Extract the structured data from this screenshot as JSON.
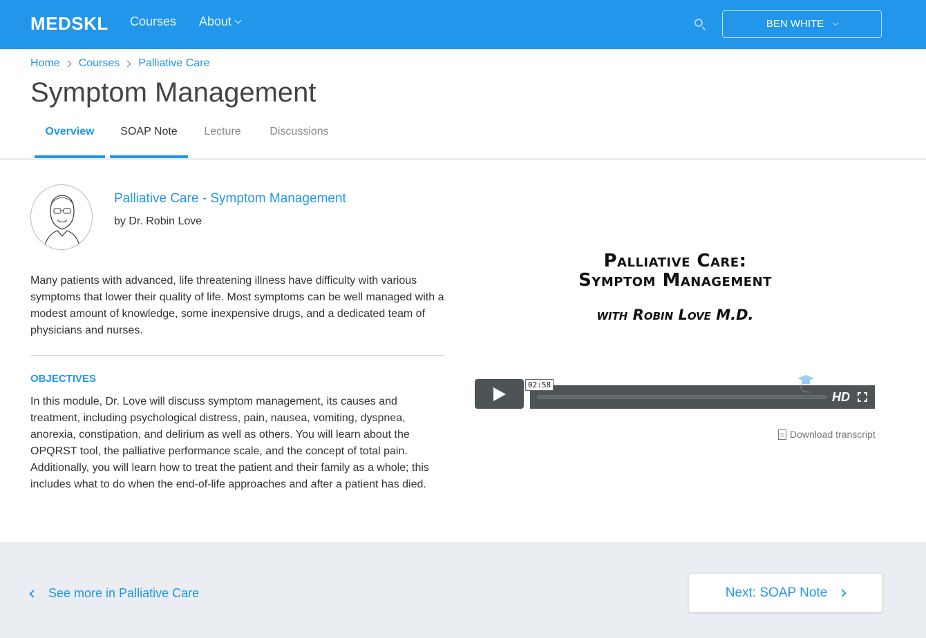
{
  "header": {
    "logo": "MEDSKL",
    "nav": {
      "courses": "Courses",
      "about": "About"
    },
    "user_name": "BEN WHITE"
  },
  "breadcrumb": [
    "Home",
    "Courses",
    "Palliative Care"
  ],
  "page_title": "Symptom Management",
  "tabs": [
    {
      "label": "Overview"
    },
    {
      "label": "SOAP Note"
    },
    {
      "label": "Lecture"
    },
    {
      "label": "Discussions"
    }
  ],
  "course": {
    "title": "Palliative Care - Symptom Management",
    "byline": "by Dr. Robin Love",
    "description": "Many patients with advanced, life threatening illness have difficulty with various symptoms that lower their quality of life. Most symptoms can be well managed with a modest amount of knowledge, some inexpensive drugs, and a dedicated team of physicians and nurses.",
    "objectives_heading": "OBJECTIVES",
    "objectives_text": "In this module, Dr. Love will discuss symptom management, its causes and treatment, including psychological distress, pain, nausea, vomiting, dyspnea, anorexia, constipation, and delirium as well as others. You will learn about the OPQRST tool, the palliative performance scale, and the concept of total pain. Additionally, you will learn how to treat the patient and their family as a whole; this includes what to do when the end-of-life approaches and after a patient has died."
  },
  "video": {
    "title_line1": "Palliative Care:",
    "title_line2": "Symptom Management",
    "subtitle": "with Robin Love M.D.",
    "duration": "02:58",
    "hd_label": "HD"
  },
  "download_label": "Download transcript",
  "footer": {
    "see_more": "See more in Palliative Care",
    "next": "Next: SOAP Note"
  },
  "colors": {
    "brand": "#2296ea",
    "footer_bg": "#eaedf1"
  }
}
